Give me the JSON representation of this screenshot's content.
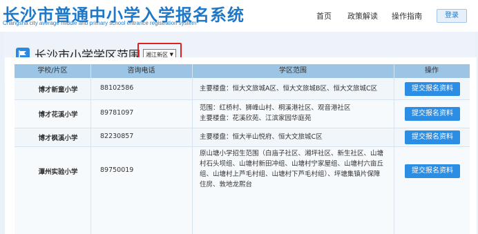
{
  "header": {
    "title": "长沙市普通中小学入学报名系统",
    "subtitle": "Changsha city average middle and primary school entrance registration system",
    "nav": {
      "home": "首页",
      "policy": "政策解读",
      "guide": "操作指南"
    },
    "login_label": "登录"
  },
  "section": {
    "title": "长沙市小学学区范围",
    "district": {
      "selected": "湘江新区",
      "arrow": "▼"
    }
  },
  "table": {
    "columns": [
      "学校/片区",
      "咨询电话",
      "学区范围",
      "操作"
    ],
    "rows": [
      {
        "school": "博才新童小学",
        "phone": "88102586",
        "range": [
          "主要楼盘：恒大文旅城A区、恒大文旅城B区、恒大文旅城C区"
        ],
        "action": "提交报名资料"
      },
      {
        "school": "博才花溪小学",
        "phone": "89781097",
        "range": [
          "范围：红桥村、狮峰山村、桐溪港社区、观音港社区",
          "主要楼盘：花溪欣苑、江滨家园华庭苑"
        ],
        "action": "提交报名资料"
      },
      {
        "school": "博才枫溪小学",
        "phone": "82230857",
        "range": [
          "主要楼盘：恒大半山悦府、恒大文旅城C区"
        ],
        "action": "提交报名资料"
      },
      {
        "school": "潭州实验小学",
        "phone": "89750019",
        "range": [
          "原山塘小学招生范围（白庙子社区、湘坪社区、新生社区、山塘",
          "村石头坝组、山塘村新田冲组、山塘村宁家屋组、山塘村六亩丘",
          "组、山塘村上芦毛村组、山塘村下芦毛村组）、坪塘集镇片保障",
          "住房、敦地龙熙台"
        ],
        "action": "提交报名资料"
      }
    ]
  },
  "colors": {
    "brand": "#1f78c7",
    "header_row": "#9cc4e4",
    "button": "#2b8de3",
    "highlight": "#e02020"
  }
}
